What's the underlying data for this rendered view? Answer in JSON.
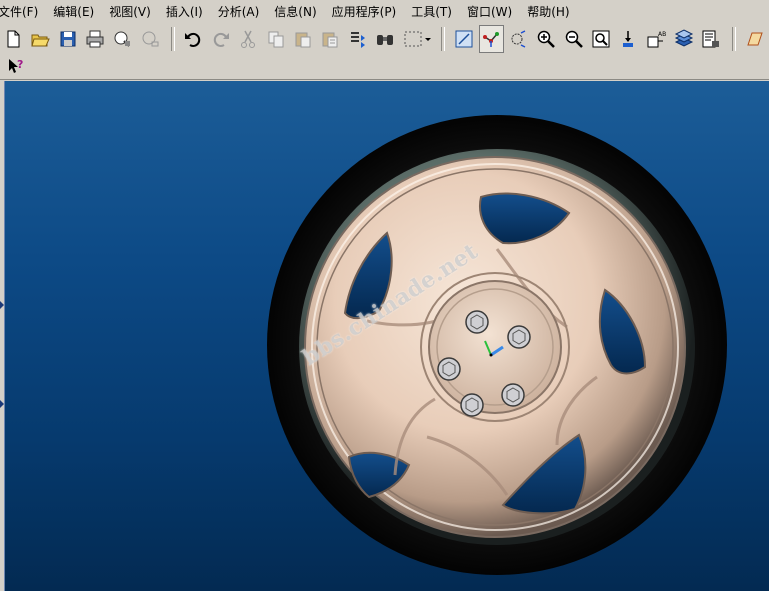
{
  "menubar": {
    "items": [
      {
        "label": "文件(F)"
      },
      {
        "label": "编辑(E)"
      },
      {
        "label": "视图(V)"
      },
      {
        "label": "插入(I)"
      },
      {
        "label": "分析(A)"
      },
      {
        "label": "信息(N)"
      },
      {
        "label": "应用程序(P)"
      },
      {
        "label": "工具(T)"
      },
      {
        "label": "窗口(W)"
      },
      {
        "label": "帮助(H)"
      }
    ]
  },
  "toolbar": {
    "icons": [
      "new-icon",
      "open-icon",
      "save-icon",
      "print-icon",
      "send-icon",
      "close-window-icon",
      "undo-icon",
      "redo-icon",
      "cut-icon",
      "copy-icon",
      "paste-icon",
      "paste-special-icon",
      "regenerate-icon",
      "find-icon",
      "select-box-icon",
      "redraw-icon",
      "spin-center-icon",
      "orient-icon",
      "zoom-in-icon",
      "zoom-out-icon",
      "refit-icon",
      "view-normal-icon",
      "saved-views-icon",
      "layers-icon",
      "model-tree-icon",
      "datum-plane-icon"
    ],
    "pressed": "spin-center-icon"
  },
  "toolbar2": {
    "icons": [
      "context-help-icon"
    ]
  },
  "viewport": {
    "watermark": "bbs.chinade.net",
    "background_top": "#1c5d98",
    "background_bottom": "#032a52"
  }
}
